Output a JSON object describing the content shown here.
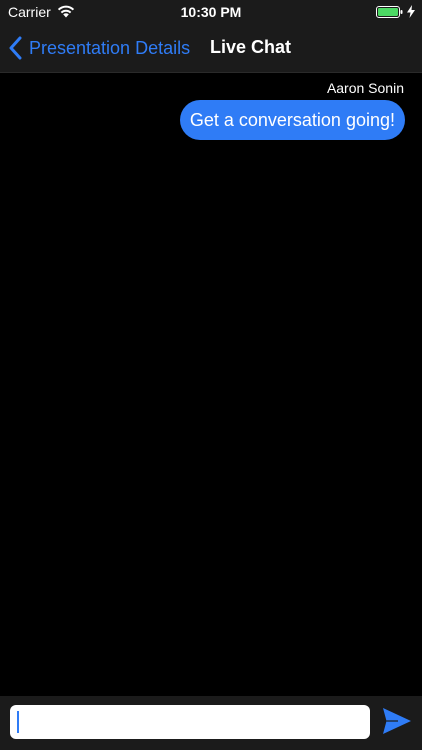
{
  "status_bar": {
    "carrier": "Carrier",
    "time": "10:30 PM",
    "battery_color": "#4cd964"
  },
  "nav": {
    "back_label": "Presentation Details",
    "title": "Live Chat",
    "accent_color": "#2f7cf6"
  },
  "messages": [
    {
      "author": "Aaron Sonin",
      "text": "Get a conversation going!"
    }
  ],
  "composer": {
    "value": "",
    "send_icon": "send-arrow-icon"
  }
}
